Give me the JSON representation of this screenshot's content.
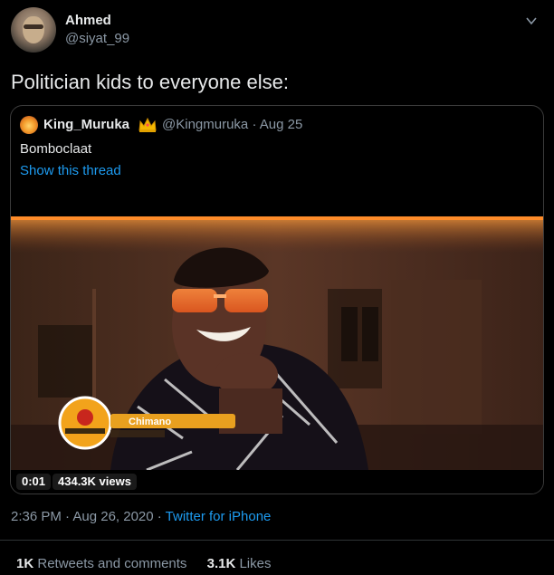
{
  "author": {
    "name": "Ahmed",
    "handle": "@siyat_99"
  },
  "tweet": {
    "text": "Politician kids to everyone else:"
  },
  "quoted_tweet": {
    "name": "King_Muruka",
    "handle": "@Kingmuruka",
    "date": "· Aug 25",
    "text": "Bomboclaat",
    "thread_link": "Show this thread",
    "video": {
      "elapsed": "0:01",
      "views": "434.3K views",
      "overlay_name": "Chimano"
    }
  },
  "meta": {
    "timestamp": "2:36 PM · Aug 26, 2020 · ",
    "source": "Twitter for iPhone"
  },
  "stats": {
    "retweets_count": "1K",
    "retweets_label": " Retweets and comments",
    "likes_count": "3.1K",
    "likes_label": " Likes"
  },
  "colors": {
    "background": "#000000",
    "link": "#1d9bf0",
    "muted": "#8b98a5",
    "text": "#e7e9ea"
  },
  "icons": {
    "more": "chevron-down-icon",
    "crown": "crown-emoji-icon"
  }
}
